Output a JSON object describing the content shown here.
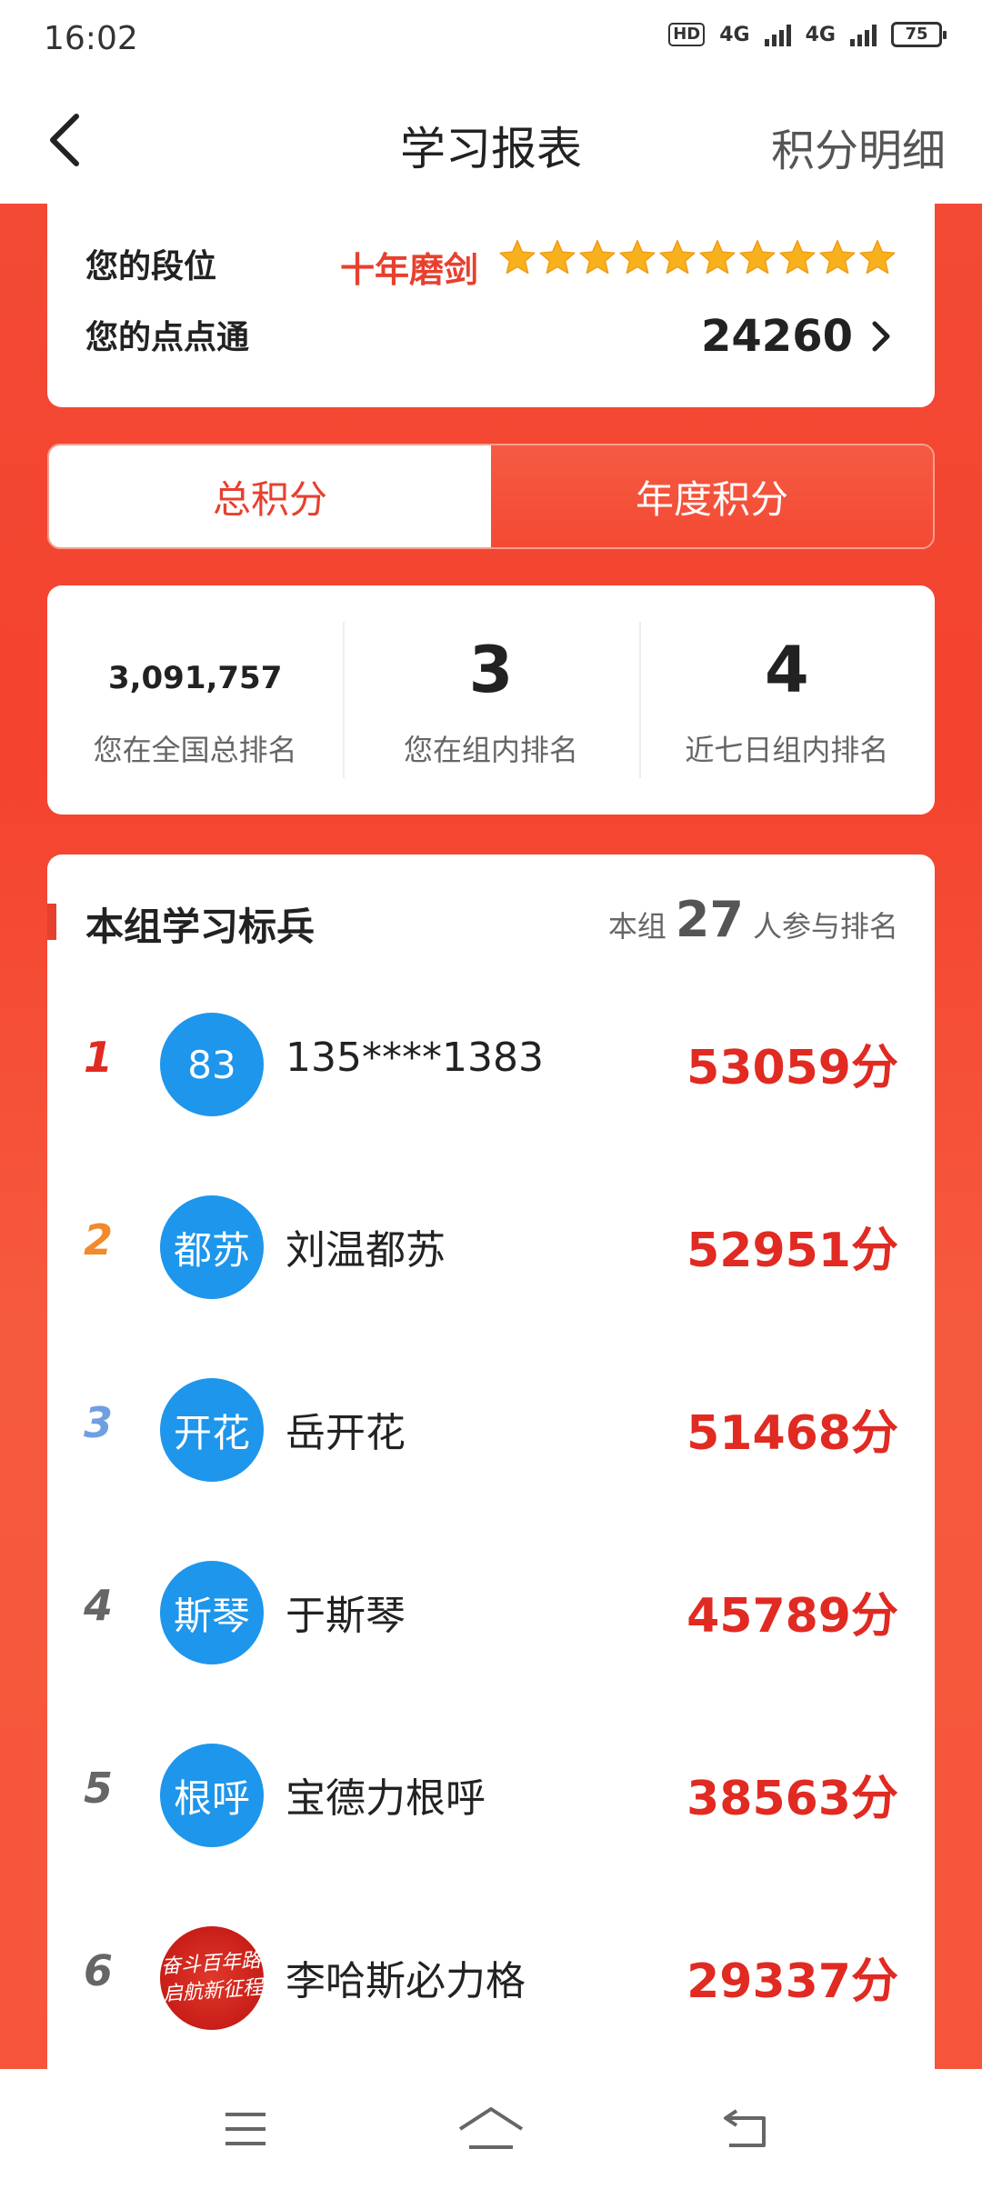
{
  "status_bar": {
    "time": "16:02",
    "hd": "HD",
    "net1": "4G",
    "net2": "4G",
    "battery": "75"
  },
  "header": {
    "title": "学习报表",
    "right_link": "积分明细"
  },
  "rank_card": {
    "level_label": "您的段位",
    "level_name": "十年磨剑",
    "stars": 10,
    "points_label": "您的点点通",
    "points": "24260"
  },
  "tabs": [
    {
      "label": "总积分",
      "active": false
    },
    {
      "label": "年度积分",
      "active": true
    }
  ],
  "stats": [
    {
      "value": "3,091,757",
      "label": "您在全国总排名"
    },
    {
      "value": "3",
      "label": "您在组内排名"
    },
    {
      "value": "4",
      "label": "近七日组内排名"
    }
  ],
  "board": {
    "title": "本组学习标兵",
    "sub_prefix": "本组",
    "count": "27",
    "sub_suffix": "人参与排名",
    "rows": [
      {
        "rank": "1",
        "avatar": "83",
        "name": "135****1383",
        "score": "53059分"
      },
      {
        "rank": "2",
        "avatar": "都苏",
        "name": "刘温都苏",
        "score": "52951分"
      },
      {
        "rank": "3",
        "avatar": "开花",
        "name": "岳开花",
        "score": "51468分"
      },
      {
        "rank": "4",
        "avatar": "斯琴",
        "name": "于斯琴",
        "score": "45789分"
      },
      {
        "rank": "5",
        "avatar": "根呼",
        "name": "宝德力根呼",
        "score": "38563分"
      },
      {
        "rank": "6",
        "avatar_image_text_line1": "奋斗百年路",
        "avatar_image_text_line2": "启航新征程",
        "name": "李哈斯必力格",
        "score": "29337分"
      }
    ]
  },
  "colors": {
    "primary_red": "#e8402f",
    "score_red": "#e02a22",
    "avatar_blue": "#1d96ec",
    "rank1": "#e02a22",
    "rank2": "#f08a2c",
    "rank3": "#6f9fe0",
    "rank_other": "#666666"
  }
}
